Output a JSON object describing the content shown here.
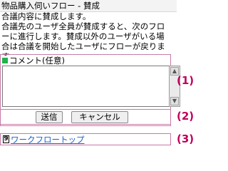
{
  "header": {
    "title": "物品購入伺いフロー - 賛成"
  },
  "description": {
    "lines": [
      "合議内容に賛成します。",
      "合議先のユーザ全員が賛成すると、次のフロ",
      "ーに進行します。賛成以外のユーザがいる場",
      "合は合議を開始したユーザにフローが戻りま",
      "す。"
    ]
  },
  "comment": {
    "label": "コメント(任意)",
    "value": ""
  },
  "scrollbar": {
    "up_icon": "arrow-up-icon",
    "down_icon": "arrow-down-icon"
  },
  "buttons": {
    "submit_label": "送信",
    "cancel_label": "キャンセル"
  },
  "footer": {
    "key_label": "9",
    "link_text": "ワークフロートップ"
  },
  "annotations": [
    "(1)",
    "(2)",
    "(3)"
  ],
  "colors": {
    "annotation": "#c0005a",
    "link": "#1a5fc9",
    "marker": "#22b14c"
  }
}
